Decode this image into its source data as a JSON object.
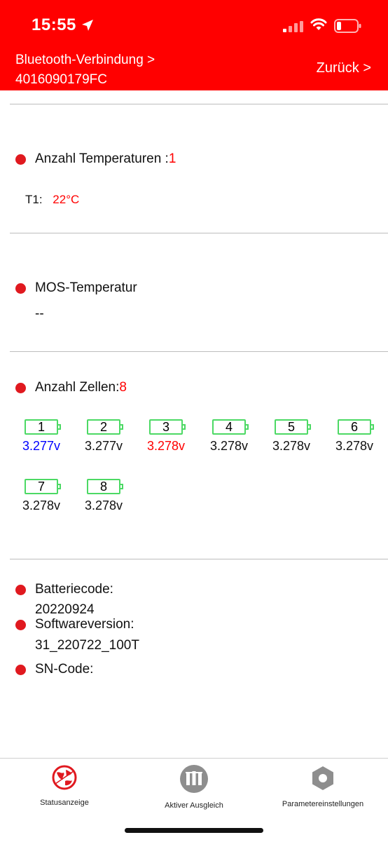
{
  "status_bar": {
    "time": "15:55"
  },
  "header": {
    "breadcrumb_line1": "Bluetooth-Verbindung >",
    "breadcrumb_line2": "4016090179FC",
    "back_label": "Zurück >"
  },
  "temperatures": {
    "label": "Anzahl Temperaturen :",
    "count": "1",
    "t1_label": "T1:",
    "t1_value": "22°C"
  },
  "mos": {
    "label": "MOS-Temperatur",
    "value": "--"
  },
  "cells": {
    "label": "Anzahl Zellen:",
    "count": "8",
    "items": [
      {
        "index": "1",
        "voltage": "3.277v",
        "color": "#0000ff"
      },
      {
        "index": "2",
        "voltage": "3.277v",
        "color": "#111111"
      },
      {
        "index": "3",
        "voltage": "3.278v",
        "color": "#ff0000"
      },
      {
        "index": "4",
        "voltage": "3.278v",
        "color": "#111111"
      },
      {
        "index": "5",
        "voltage": "3.278v",
        "color": "#111111"
      },
      {
        "index": "6",
        "voltage": "3.278v",
        "color": "#111111"
      },
      {
        "index": "7",
        "voltage": "3.278v",
        "color": "#111111"
      },
      {
        "index": "8",
        "voltage": "3.278v",
        "color": "#111111"
      }
    ]
  },
  "info": {
    "battery_code_label": "Batteriecode:",
    "battery_code_value": "20220924",
    "software_label": "Softwareversion:",
    "software_value": "31_220722_100T",
    "sn_label": "SN-Code:"
  },
  "tabs": [
    {
      "label": "Statusanzeige",
      "icon": "globe-icon"
    },
    {
      "label": "Aktiver Ausgleich",
      "icon": "balance-icon"
    },
    {
      "label": "Parametereinstellungen",
      "icon": "hexagon-gear-icon"
    }
  ],
  "colors": {
    "header_bg": "#ff0000",
    "accent_red": "#ff0000",
    "dot_red": "#e0191f",
    "cell_border": "#4cd964"
  }
}
